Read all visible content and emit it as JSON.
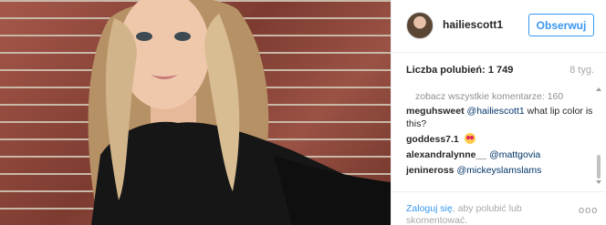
{
  "post": {
    "username": "hailiescott1",
    "follow_label": "Obserwuj",
    "likes_label": "Liczba polubień: 1 749",
    "time_ago": "8 tyg."
  },
  "comments": {
    "view_all": "zobacz wszystkie komentarze: 160",
    "items": [
      {
        "author": "meguhsweet",
        "mention": "@hailiescott1",
        "text": " what lip color is this?"
      },
      {
        "author": "goddess7.1",
        "emoji": "heart-eyes-emoji"
      },
      {
        "author": "alexandralynne__",
        "mention": "@mattgovia"
      },
      {
        "author": "jenineross",
        "mention": "@mickeyslamslams"
      }
    ]
  },
  "footer": {
    "login_link": "Zaloguj się",
    "login_rest": ", aby polubić lub skomentować.",
    "more": "ooo"
  },
  "colors": {
    "accent": "#3897f0",
    "mention": "#003569",
    "muted": "#a5a7aa",
    "brick": "#8e4a3a"
  }
}
